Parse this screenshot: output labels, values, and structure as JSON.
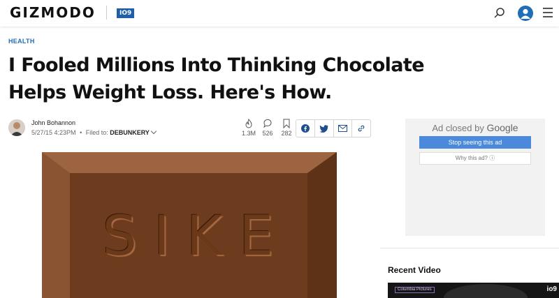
{
  "header": {
    "logo": "GIZMODO",
    "sub_brand": "IO9",
    "icons": [
      "search-icon",
      "user-avatar-icon",
      "menu-icon"
    ]
  },
  "article": {
    "category": "HEALTH",
    "title": "I Fooled Millions Into Thinking Chocolate Helps Weight Loss. Here's How.",
    "author": "John Bohannon",
    "date": "5/27/15 4:23PM",
    "separator": "•",
    "filed_label": "Filed to:",
    "filed_tag": "DEBUNKERY",
    "stats": {
      "views": "1.3M",
      "comments": "526",
      "saves": "282"
    },
    "share_icons": [
      "facebook-icon",
      "twitter-icon",
      "email-icon",
      "link-icon"
    ],
    "hero_text": "SIKE"
  },
  "ad": {
    "closed_prefix": "Ad closed by",
    "closed_brand": "Google",
    "stop_label": "Stop seeing this ad",
    "why_label": "Why this ad? ⓘ"
  },
  "sidebar": {
    "recent_video_heading": "Recent Video",
    "video_badge": "Columbia Pictures",
    "video_brand": "io9"
  },
  "colors": {
    "accent": "#1f6fb8",
    "io9_badge": "#1f5fa8",
    "ad_button": "#4a89dc",
    "chocolate": "#6b3b1c"
  }
}
